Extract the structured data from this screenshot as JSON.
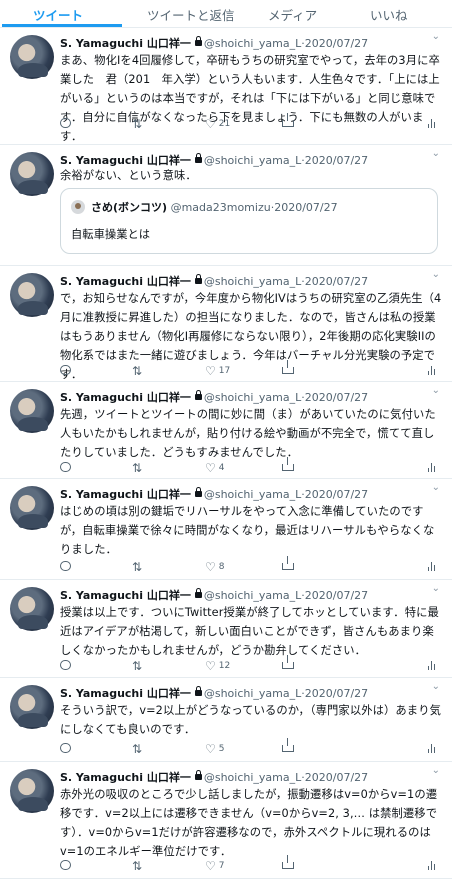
{
  "tabs": [
    "ツイート",
    "ツイートと返信",
    "メディア",
    "いいね"
  ],
  "author": {
    "name": "S. Yamaguchi 山口祥一",
    "handle": "@shoichi_yama_L",
    "date": "2020/07/27"
  },
  "tweets": [
    {
      "text": "まあ、物化Iを4回履修して，卒研もうちの研究室でやって，去年の3月に卒業した　君（201　年入学）という人もいます．人生色々です．「上には上がいる」というのは本当ですが，それは「下には下がいる」と同じ意味です．自分に自信がなくなったら下を見ましょう．下にも無数の人がいます．",
      "likes": "21",
      "retweets": "",
      "replies": ""
    },
    {
      "text": "余裕がない、という意味．",
      "likes": "",
      "retweets": "",
      "replies": "",
      "quote": {
        "name": "さめ(ボンコツ)",
        "handle": "@mada23momizu",
        "date": "2020/07/27",
        "text": "自転車操業とは"
      }
    },
    {
      "text": "で，お知らせなんですが，今年度から物化IVはうちの研究室の乙須先生（4月に准教授に昇進した）の担当になりました．なので，皆さんは私の授業はもうありません（物化I再履修にならない限り），2年後期の応化実験IIの物化系ではまた一緒に遊びましょう．今年はバーチャル分光実験の予定です．",
      "likes": "17",
      "retweets": "",
      "replies": ""
    },
    {
      "text": "先週，ツイートとツイートの間に妙に間（ま）があいていたのに気付いた人もいたかもしれませんが，貼り付ける絵や動画が不完全で，慌てて直したりしていました．どうもすみませんでした．",
      "likes": "4",
      "retweets": "",
      "replies": ""
    },
    {
      "text": "はじめの頃は別の鍵垢でリハーサルをやって入念に準備していたのですが，自転車操業で徐々に時間がなくなり，最近はリハーサルもやらなくなりました．",
      "likes": "8",
      "retweets": "",
      "replies": ""
    },
    {
      "text": "授業は以上です．ついにTwitter授業が終了してホッとしています．特に最近はアイデアが枯渇して，新しい面白いことができず，皆さんもあまり楽しくなかったかもしれませんが，どうか勘弁してください．",
      "likes": "12",
      "retweets": "",
      "replies": ""
    },
    {
      "text": "そういう訳で，v=2以上がどうなっているのか，（専門家以外は）あまり気にしなくても良いのです．",
      "likes": "5",
      "retweets": "",
      "replies": ""
    },
    {
      "text": "赤外光の吸収のところで少し話しましたが，振動遷移はv=0からv=1の遷移です．v=2以上には遷移できません（v=0からv=2, 3,… は禁制遷移です）．v=0からv=1だけが許容遷移なので，赤外スペクトルに現れるのはv=1のエネルギー準位だけです．",
      "likes": "7",
      "retweets": "",
      "replies": ""
    }
  ]
}
